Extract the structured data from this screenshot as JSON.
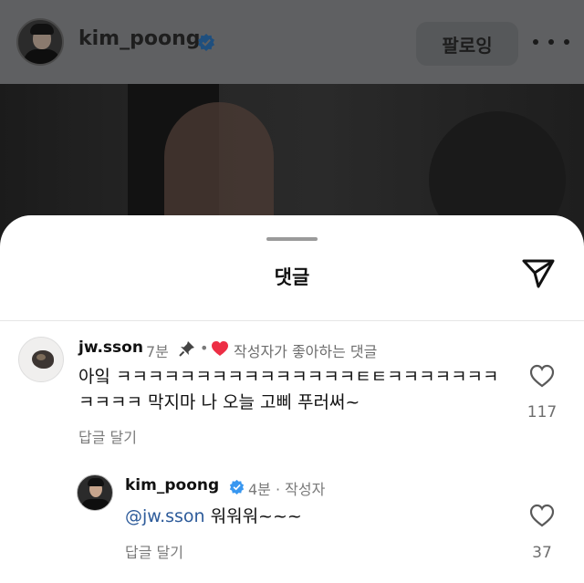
{
  "header": {
    "username": "kim_poong",
    "follow_label": "팔로잉",
    "icons": [
      "avatar",
      "verified-badge-icon",
      "more-dots-icon"
    ]
  },
  "sheet": {
    "title": "댓글",
    "icons": [
      "send-icon"
    ]
  },
  "comment": {
    "username": "jw.sson",
    "time": "7분",
    "separator": "•",
    "liked_by_author": "작성자가 좋아하는 댓글",
    "text": "아잌 ㅋㅋㅋㅋㅋㅋㅋㅋㅋㅋㅋㅋㅋㅋㅋㅌㅌㅋㅋㅋㅋㅋㅋㅋㅋㅋㅋㅋ 막지마 나 오늘 고삐 푸러써~",
    "reply_label": "답글 달기",
    "like_count": "117",
    "icons": [
      "pin-icon",
      "red-heart-icon",
      "heart-outline-icon"
    ]
  },
  "reply": {
    "username": "kim_poong",
    "meta": "4분 · 작성자",
    "mention": "@jw.sson",
    "text": " 워워워~~~",
    "reply_label": "답글 달기",
    "like_count": "37",
    "icons": [
      "verified-badge-icon",
      "heart-outline-icon"
    ]
  },
  "colors": {
    "accent_blue": "#3897f0",
    "mention_blue": "#2d5b9a",
    "heart_red": "#ed2e45",
    "muted_text": "#7a7a7a"
  }
}
